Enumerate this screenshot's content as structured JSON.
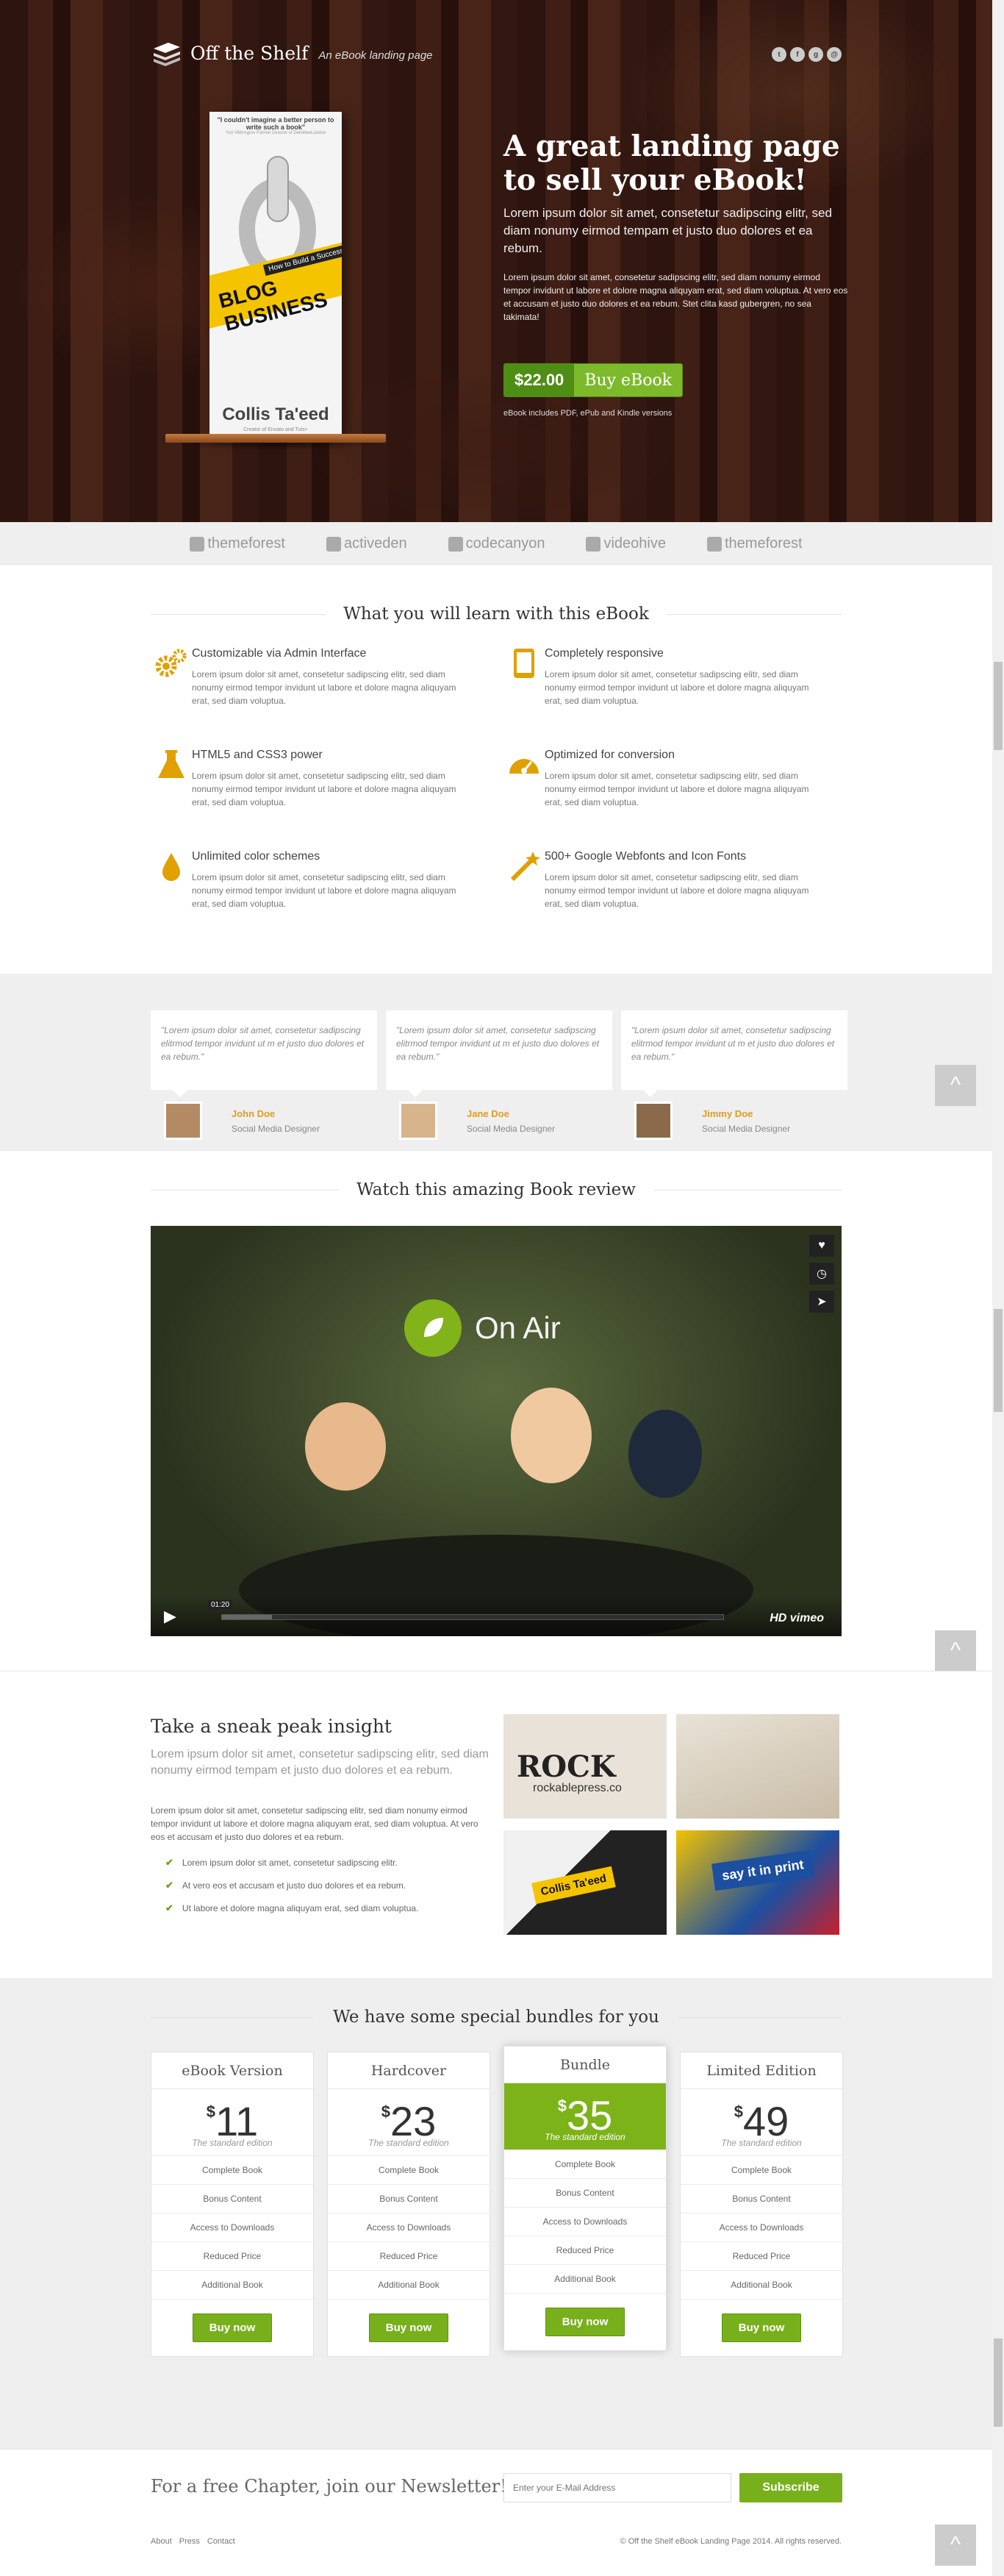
{
  "header": {
    "logo_name": "Off the Shelf",
    "logo_tagline": "An eBook landing page",
    "social_icons": [
      "twitter-icon",
      "facebook-icon",
      "googleplus-icon",
      "email-icon"
    ],
    "social_glyphs": [
      "t",
      "f",
      "g",
      "@"
    ]
  },
  "book": {
    "quote": "\"I couldn't imagine a better person to write such a book\"",
    "quote_source": "Yuri Vikhrogrov Former Director of DeloitteeLondon",
    "subtitle": "How to Build a Successful",
    "title": "BLOG BUSINESS",
    "author": "Collis Ta'eed",
    "author_sub": "Creator of Envato and Tuts+"
  },
  "hero": {
    "title": "A great landing page to sell your eBook!",
    "lead": "Lorem ipsum dolor sit amet, consetetur sadipscing elitr, sed diam nonumy eirmod tempam et justo duo dolores et ea rebum.",
    "body": "Lorem ipsum dolor sit amet, consetetur sadipscing elitr, sed diam nonumy eirmod tempor invidunt ut labore et dolore magna aliquyam erat, sed diam voluptua. At vero eos et accusam et justo duo dolores et ea rebum. Stet clita kasd gubergren, no sea takimata!",
    "price": "$22.00",
    "buy_label": "Buy eBook",
    "note": "eBook includes PDF, ePub and Kindle versions"
  },
  "partners": [
    "themeforest",
    "activeden",
    "codecanyon",
    "videohive",
    "themeforest"
  ],
  "features": {
    "heading": "What you will learn with this eBook",
    "items": [
      {
        "title": "Customizable via Admin Interface",
        "text": "Lorem ipsum dolor sit amet, consetetur sadipscing elitr, sed diam nonumy eirmod tempor invidunt ut labore et dolore magna aliquyam erat, sed diam voluptua.",
        "icon": "gears-icon"
      },
      {
        "title": "Completely responsive",
        "text": "Lorem ipsum dolor sit amet, consetetur sadipscing elitr, sed diam nonumy eirmod tempor invidunt ut labore et dolore magna aliquyam erat, sed diam voluptua.",
        "icon": "tablet-icon"
      },
      {
        "title": "HTML5 and CSS3 power",
        "text": "Lorem ipsum dolor sit amet, consetetur sadipscing elitr, sed diam nonumy eirmod tempor invidunt ut labore et dolore magna aliquyam erat, sed diam voluptua.",
        "icon": "flask-icon"
      },
      {
        "title": "Optimized for conversion",
        "text": "Lorem ipsum dolor sit amet, consetetur sadipscing elitr, sed diam nonumy eirmod tempor invidunt ut labore et dolore magna aliquyam erat, sed diam voluptua.",
        "icon": "dashboard-icon"
      },
      {
        "title": "Unlimited color schemes",
        "text": "Lorem ipsum dolor sit amet, consetetur sadipscing elitr, sed diam nonumy eirmod tempor invidunt ut labore et dolore magna aliquyam erat, sed diam voluptua.",
        "icon": "drop-icon"
      },
      {
        "title": "500+ Google Webfonts and Icon Fonts",
        "text": "Lorem ipsum dolor sit amet, consetetur sadipscing elitr, sed diam nonumy eirmod tempor invidunt ut labore et dolore magna aliquyam erat, sed diam voluptua.",
        "icon": "magic-wand-icon"
      }
    ]
  },
  "testimonials": [
    {
      "quote": "\"Lorem ipsum dolor sit amet, consetetur sadipscing elitrmod tempor invidunt ut m et justo duo dolores et ea rebum.\"",
      "name": "John Doe",
      "role": "Social Media Designer"
    },
    {
      "quote": "\"Lorem ipsum dolor sit amet, consetetur sadipscing elitrmod tempor invidunt ut m et justo duo dolores et ea rebum.\"",
      "name": "Jane Doe",
      "role": "Social Media Designer"
    },
    {
      "quote": "\"Lorem ipsum dolor sit amet, consetetur sadipscing elitrmod tempor invidunt ut m et justo duo dolores et ea rebum.\"",
      "name": "Jimmy Doe",
      "role": "Social Media Designer"
    }
  ],
  "video": {
    "heading": "Watch this amazing Book review",
    "on_air": "On Air",
    "time": "01:20",
    "buffered_fraction": 0.1,
    "hd": "HD",
    "vimeo": "vimeo",
    "side_icons": [
      "heart-icon",
      "clock-icon",
      "send-icon"
    ]
  },
  "sneak": {
    "heading": "Take a sneak peak insight",
    "lead": "Lorem ipsum dolor sit amet, consetetur sadipscing elitr, sed diam nonumy eirmod tempam et justo duo dolores et ea rebum.",
    "body": "Lorem ipsum dolor sit amet, consetetur sadipscing elitr, sed diam nonumy eirmod tempor invidunt ut labore et dolore magna aliquyam erat, sed diam voluptua. At vero eos et accusam et justo duo dolores et ea rebum.",
    "bullets": [
      "Lorem ipsum dolor sit amet, consetetur sadipscing elitr.",
      "At vero eos et accusam et justo duo dolores et ea rebum.",
      "Ut labore et dolore magna aliquyam erat, sed diam voluptua."
    ],
    "gallery": {
      "img1_line1": "ROCK",
      "img1_line2": "rockablepress.co",
      "img3_text": "Collis Ta'eed",
      "img4_text": "say it in print"
    }
  },
  "pricing": {
    "heading": "We have some special bundles for you",
    "plans": [
      {
        "name": "eBook Version",
        "currency": "$",
        "amount": "11",
        "subtitle": "The standard edition",
        "featured": false
      },
      {
        "name": "Hardcover",
        "currency": "$",
        "amount": "23",
        "subtitle": "The standard edition",
        "featured": false
      },
      {
        "name": "Bundle",
        "currency": "$",
        "amount": "35",
        "subtitle": "The standard edition",
        "featured": true
      },
      {
        "name": "Limited Edition",
        "currency": "$",
        "amount": "49",
        "subtitle": "The standard edition",
        "featured": false
      }
    ],
    "items": [
      "Complete Book",
      "Bonus Content",
      "Access to Downloads",
      "Reduced Price",
      "Additional Book"
    ],
    "cta": "Buy now"
  },
  "newsletter": {
    "title": "For a free Chapter, join our Newsletter!",
    "placeholder": "Enter your E-Mail Address",
    "button": "Subscribe"
  },
  "footer": {
    "links": [
      "About",
      "Press",
      "Contact"
    ],
    "copyright": "© Off the Shelf eBook Landing Page 2014. All rights reserved."
  },
  "colors": {
    "accent": "#7cb319",
    "accent_dark": "#4f8e14",
    "orange": "#e39b1f",
    "icon_yellow": "#e0a000"
  }
}
